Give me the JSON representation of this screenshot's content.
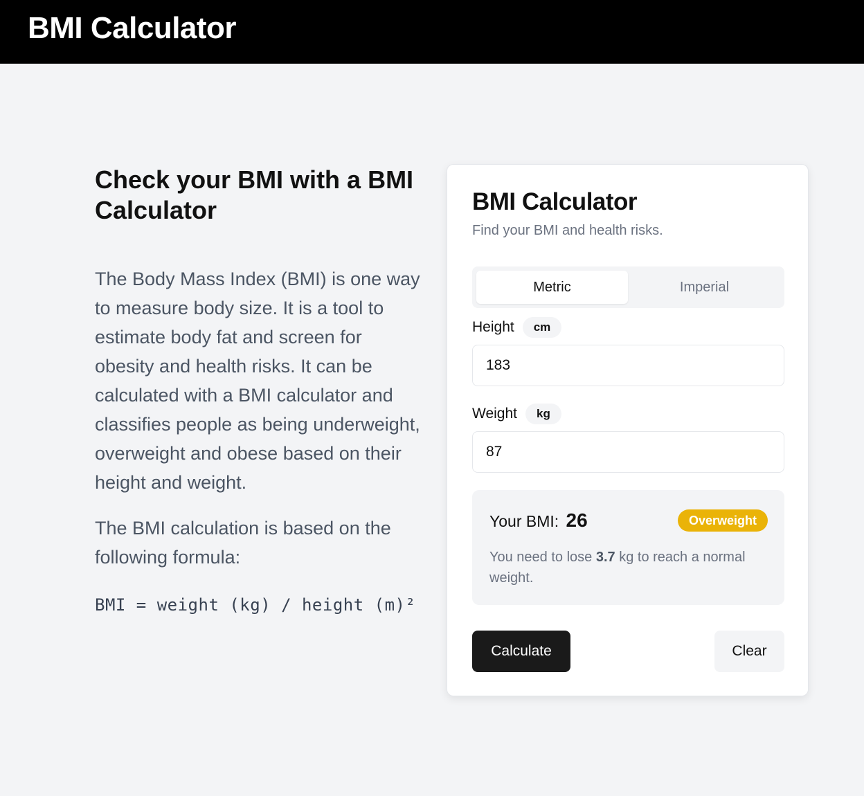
{
  "header": {
    "title": "BMI Calculator"
  },
  "intro": {
    "heading": "Check your BMI with a BMI Calculator",
    "paragraph1": "The Body Mass Index (BMI) is one way to measure body size. It is a tool to estimate body fat and screen for obesity and health risks. It can be calculated with a BMI calculator and classifies people as being underweight, overweight and obese based on their height and weight.",
    "paragraph2": "The BMI calculation is based on the following formula:",
    "formula": "BMI = weight (kg) / height (m)²"
  },
  "calculator": {
    "title": "BMI Calculator",
    "subtitle": "Find your BMI and health risks.",
    "unit_toggle": {
      "active": "Metric",
      "inactive": "Imperial"
    },
    "height": {
      "label": "Height",
      "unit": "cm",
      "value": "183"
    },
    "weight": {
      "label": "Weight",
      "unit": "kg",
      "value": "87"
    },
    "result": {
      "label": "Your BMI:",
      "value": "26",
      "status": "Overweight",
      "status_color": "#eab308",
      "advice_prefix": "You need to lose",
      "advice_amount": "3.7",
      "advice_suffix": "kg to reach a normal weight."
    },
    "buttons": {
      "calculate": "Calculate",
      "clear": "Clear"
    }
  }
}
